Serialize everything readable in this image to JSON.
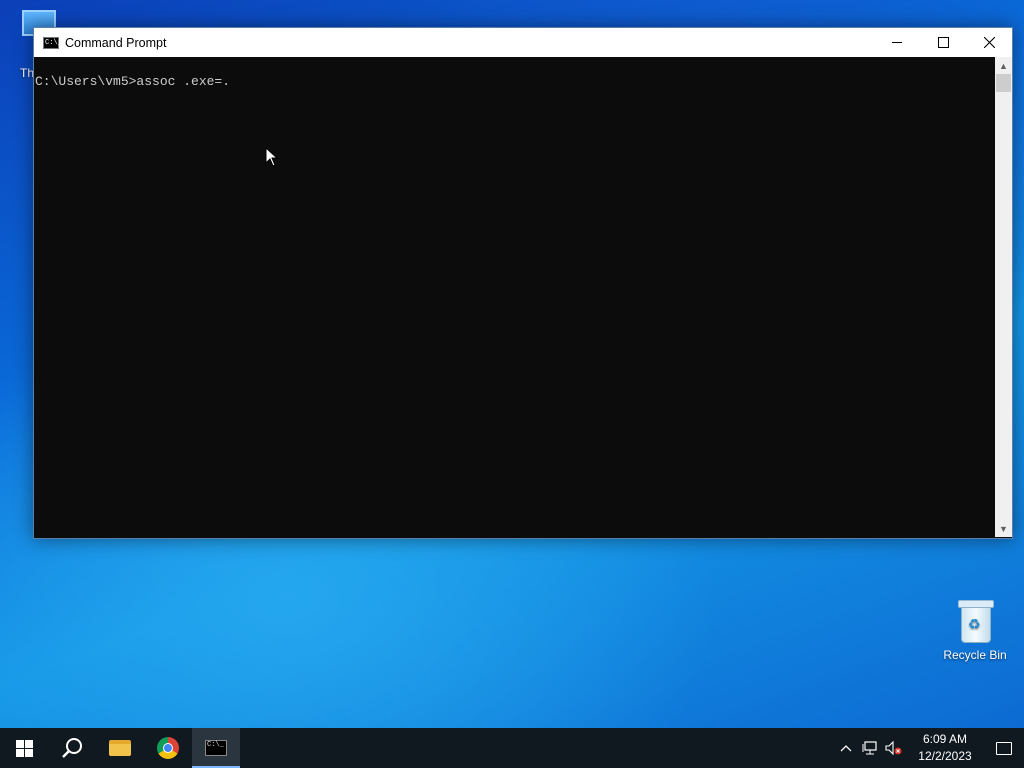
{
  "desktop": {
    "icons": [
      {
        "label": "Th"
      },
      {
        "label": "Recycle Bin"
      }
    ]
  },
  "window": {
    "title": "Command Prompt",
    "title_icon_text": "C:\\_",
    "console_lines": [
      "C:\\Users\\vm5>assoc .exe=."
    ]
  },
  "taskbar": {
    "pinned": [
      "windows-start-icon",
      "search-icon",
      "file-explorer-icon",
      "chrome-icon",
      "command-prompt-icon"
    ],
    "clock": {
      "time": "6:09 AM",
      "date": "12/2/2023"
    }
  },
  "colors": {
    "console_bg": "#0c0c0c",
    "console_fg": "#cccccc",
    "taskbar_bg": "#101820",
    "accent": "#7fb6ff"
  }
}
